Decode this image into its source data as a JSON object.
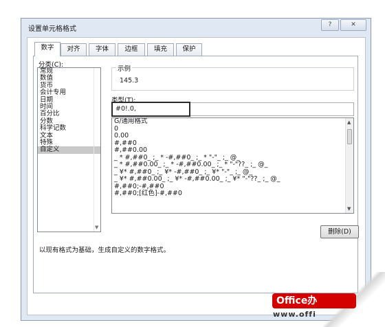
{
  "dialog": {
    "title": "设置单元格格式",
    "help_label": "?",
    "close_label": "✕"
  },
  "tabs": [
    {
      "label": "数字",
      "active": true
    },
    {
      "label": "对齐"
    },
    {
      "label": "字体"
    },
    {
      "label": "边框"
    },
    {
      "label": "填充"
    },
    {
      "label": "保护"
    }
  ],
  "category": {
    "label": "分类(C):",
    "items": [
      "常规",
      "数值",
      "货币",
      "会计专用",
      "日期",
      "时间",
      "百分比",
      "分数",
      "科学记数",
      "文本",
      "特殊",
      "自定义"
    ],
    "selected": "自定义"
  },
  "sample": {
    "label": "示例",
    "value": "145.3"
  },
  "type": {
    "label": "类型(T):",
    "value": "#0!.0,"
  },
  "formats": [
    "G/通用格式",
    "0",
    "0.00",
    "#,##0",
    "#,##0.00",
    "_ * #,##0_ ;_ * -#,##0_ ;_ * \"-\"_ ;_ @_",
    "_ * #,##0.00_ ;_ * -#,##0.00_ ;_ * \"-\"??_ ;_ @_",
    "_ ¥* #,##0_ ;_ ¥* -#,##0_ ;_ ¥* \"-\"_ ;_ @_",
    "_ ¥* #,##0.00_ ;_ ¥* -#,##0.00_ ;_ ¥* \"-\"??_ ;_ @_",
    "#,##0;-#,##0",
    "#,##0;[红色]-#,##0"
  ],
  "buttons": {
    "delete_label": "删除(D)"
  },
  "description": "以现有格式为基础，生成自定义的数字格式。",
  "watermark": {
    "brand": "Office办",
    "url": "www.offi"
  },
  "colors": {
    "dialog_frame": "#dfe8f3",
    "selected_item": "#c9c9c9",
    "brand_red": "#d40000"
  }
}
